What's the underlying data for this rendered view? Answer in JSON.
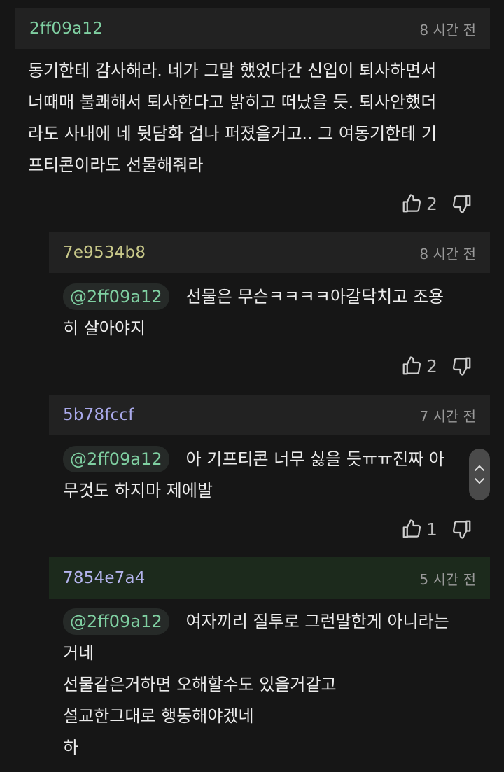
{
  "comments": [
    {
      "author": "2ff09a12",
      "author_color": "#7fcfa1",
      "time": "8 시간 전",
      "lines": [
        "동기한테 감사해라. 네가 그말 했었다간 신입이 퇴사하면서",
        "너때매 불쾌해서 퇴사한다고 밝히고 떠났을 듯. 퇴사안했더",
        "라도 사내에 네 뒷담화 겁나 퍼졌을거고.. 그 여동기한테 기",
        "프티콘이라도 선물해줘라"
      ],
      "likes": "2"
    }
  ],
  "replies": [
    {
      "author": "7e9534b8",
      "author_color": "#c9c98a",
      "time": "8 시간 전",
      "mention": "@2ff09a12",
      "first_line": "선물은 무슨ㅋㅋㅋㅋ아갈닥치고 조용",
      "more_lines": [
        "히 살아야지"
      ],
      "likes": "2"
    },
    {
      "author": "5b78fccf",
      "author_color": "#a9a9ea",
      "time": "7 시간 전",
      "mention": "@2ff09a12",
      "first_line": "아 기프티콘 너무 싫을 듯ㅠㅠ진짜 아",
      "more_lines": [
        "무것도 하지마 제에발"
      ],
      "likes": "1"
    },
    {
      "author": "7854e7a4",
      "author_color": "#b4b4ee",
      "time": "5 시간 전",
      "mention": "@2ff09a12",
      "first_line": "여자끼리 질투로 그런말한게 아니라는",
      "more_lines": [
        "거네",
        "선물같은거하면 오해할수도 있을거같고",
        "설교한그대로 행동해야겠네",
        "하"
      ]
    }
  ],
  "icons": {
    "like": "thumbs-up-icon",
    "dislike": "thumbs-down-icon",
    "scroll_up": "chevron-up-icon",
    "scroll_down": "chevron-down-icon"
  },
  "colors": {
    "background": "#161616",
    "header_bg": "#222222",
    "highlight_header_bg": "#1c2a1c",
    "mention": "#7fcfa1"
  }
}
